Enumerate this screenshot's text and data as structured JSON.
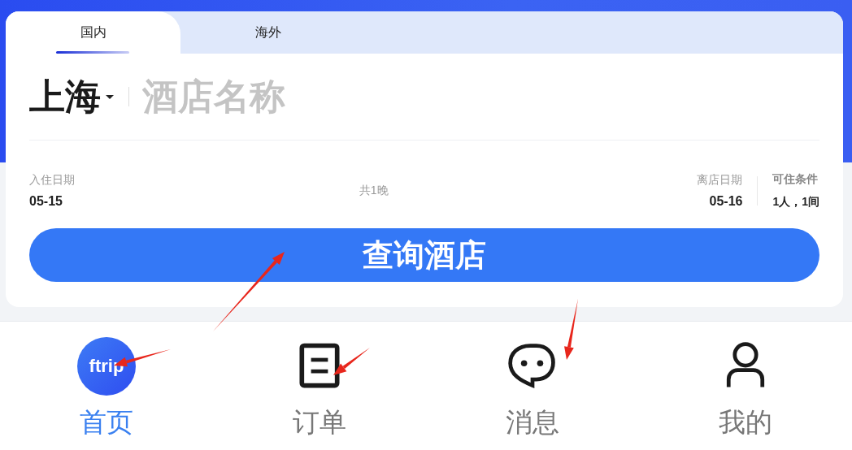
{
  "tabs": [
    {
      "label": "国内",
      "selected": true
    },
    {
      "label": "海外",
      "selected": false
    }
  ],
  "search": {
    "city": "上海",
    "hotel_name": {
      "placeholder": "酒店名称"
    }
  },
  "dates": {
    "check_in": {
      "label": "入住日期",
      "value": "05-15"
    },
    "nights": "共1晚",
    "check_out": {
      "label": "离店日期",
      "value": "05-16"
    }
  },
  "occupancy": {
    "label": "可住条件",
    "value": "1人，1间"
  },
  "search_button": "查询酒店",
  "nav": [
    {
      "kind": "home",
      "logo": "ftrip",
      "label": "首页",
      "selected": true
    },
    {
      "kind": "orders",
      "label": "订单",
      "selected": false
    },
    {
      "kind": "messages",
      "label": "消息",
      "selected": false
    },
    {
      "kind": "profile",
      "label": "我的",
      "selected": false
    }
  ]
}
